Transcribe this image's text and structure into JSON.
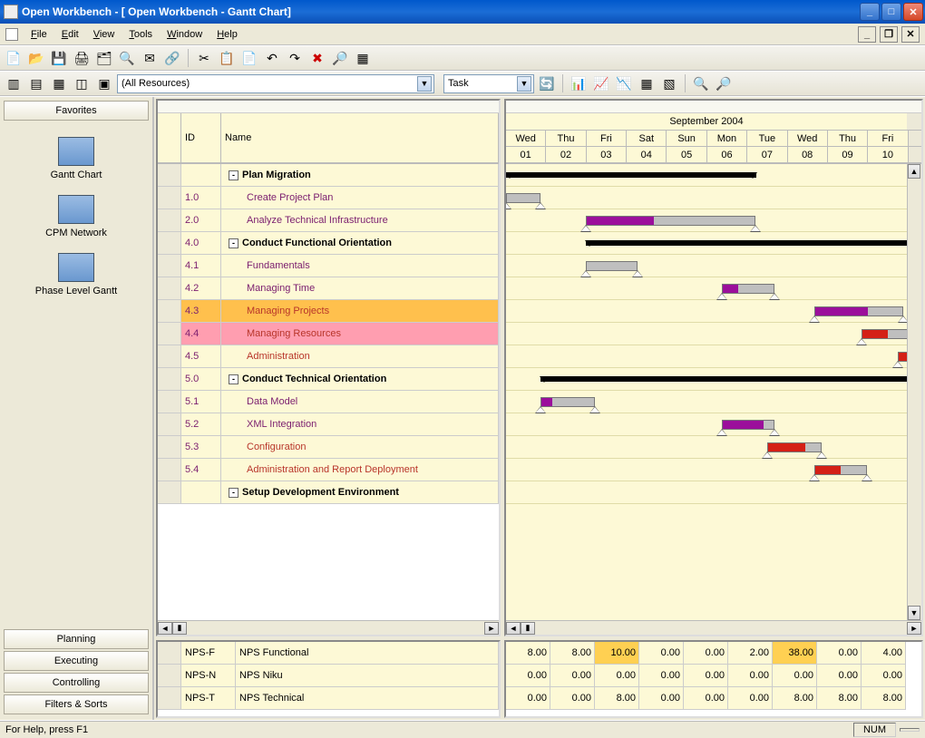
{
  "window": {
    "title": "Open Workbench - [   Open Workbench - Gantt Chart]"
  },
  "menu": {
    "items": [
      "File",
      "Edit",
      "View",
      "Tools",
      "Window",
      "Help"
    ]
  },
  "toolbar2": {
    "resource_filter": "(All Resources)",
    "shown_type": "Task"
  },
  "sidebar": {
    "favorites": "Favorites",
    "views": [
      {
        "label": "Gantt Chart"
      },
      {
        "label": "CPM Network"
      },
      {
        "label": "Phase Level Gantt"
      }
    ],
    "bottom": [
      "Planning",
      "Executing",
      "Controlling",
      "Filters & Sorts"
    ]
  },
  "grid": {
    "headers": {
      "id": "ID",
      "name": "Name"
    },
    "timeline": {
      "month": "September 2004",
      "days": [
        "Wed",
        "Thu",
        "Fri",
        "Sat",
        "Sun",
        "Mon",
        "Tue",
        "Wed",
        "Thu",
        "Fri"
      ],
      "dates": [
        "01",
        "02",
        "03",
        "04",
        "05",
        "06",
        "07",
        "08",
        "09",
        "10"
      ]
    },
    "rows": [
      {
        "id": "",
        "name": "Plan Migration",
        "type": "summary",
        "collapsible": true,
        "bar": {
          "start": 0,
          "end": 276,
          "kind": "summary"
        }
      },
      {
        "id": "1.0",
        "name": "Create Project Plan",
        "type": "task",
        "style": "purple",
        "bar": {
          "start": 0,
          "end": 38,
          "kind": "task",
          "prog": 0
        }
      },
      {
        "id": "2.0",
        "name": "Analyze Technical Infrastructure",
        "type": "task",
        "style": "purple",
        "bar": {
          "start": 88,
          "end": 275,
          "kind": "task",
          "prog": 40,
          "progcolor": "purple"
        }
      },
      {
        "id": "4.0",
        "name": "Conduct Functional Orientation",
        "type": "summary",
        "collapsible": true,
        "bar": {
          "start": 88,
          "end": 450,
          "kind": "summary"
        }
      },
      {
        "id": "4.1",
        "name": "Fundamentals",
        "type": "task",
        "style": "purple",
        "bar": {
          "start": 88,
          "end": 145,
          "kind": "task",
          "prog": 0
        }
      },
      {
        "id": "4.2",
        "name": "Managing Time",
        "type": "task",
        "style": "purple",
        "bar": {
          "start": 238,
          "end": 296,
          "kind": "task",
          "prog": 30,
          "progcolor": "purple"
        }
      },
      {
        "id": "4.3",
        "name": "Managing Projects",
        "type": "task",
        "style": "red",
        "hl": "orange",
        "bar": {
          "start": 340,
          "end": 438,
          "kind": "task",
          "prog": 60,
          "progcolor": "purple"
        }
      },
      {
        "id": "4.4",
        "name": "Managing Resources",
        "type": "task",
        "style": "red",
        "hl": "pink",
        "bar": {
          "start": 392,
          "end": 450,
          "kind": "task",
          "prog": 50,
          "progcolor": "red"
        }
      },
      {
        "id": "4.5",
        "name": "Administration",
        "type": "task",
        "style": "red",
        "bar": {
          "start": 432,
          "end": 450,
          "kind": "task",
          "prog": 100,
          "progcolor": "red"
        }
      },
      {
        "id": "5.0",
        "name": "Conduct Technical Orientation",
        "type": "summary",
        "collapsible": true,
        "bar": {
          "start": 38,
          "end": 450,
          "kind": "summary"
        }
      },
      {
        "id": "5.1",
        "name": "Data Model",
        "type": "task",
        "style": "purple",
        "bar": {
          "start": 38,
          "end": 98,
          "kind": "task",
          "prog": 20,
          "progcolor": "purple"
        }
      },
      {
        "id": "5.2",
        "name": "XML Integration",
        "type": "task",
        "style": "purple",
        "bar": {
          "start": 238,
          "end": 296,
          "kind": "task",
          "prog": 80,
          "progcolor": "purple"
        }
      },
      {
        "id": "5.3",
        "name": "Configuration",
        "type": "task",
        "style": "red",
        "bar": {
          "start": 288,
          "end": 348,
          "kind": "task",
          "prog": 70,
          "progcolor": "red"
        }
      },
      {
        "id": "5.4",
        "name": "Administration and Report Deployment",
        "type": "task",
        "style": "red",
        "bar": {
          "start": 340,
          "end": 398,
          "kind": "task",
          "prog": 50,
          "progcolor": "red"
        }
      },
      {
        "id": "",
        "name": "Setup Development Environment",
        "type": "summary",
        "collapsible": true,
        "bar": null
      }
    ]
  },
  "resources": {
    "rows": [
      {
        "code": "NPS-F",
        "name": "NPS Functional",
        "values": [
          "8.00",
          "8.00",
          "10.00",
          "0.00",
          "0.00",
          "2.00",
          "38.00",
          "0.00",
          "4.00"
        ],
        "hl": [
          2,
          6
        ]
      },
      {
        "code": "NPS-N",
        "name": "NPS Niku",
        "values": [
          "0.00",
          "0.00",
          "0.00",
          "0.00",
          "0.00",
          "0.00",
          "0.00",
          "0.00",
          "0.00"
        ],
        "hl": []
      },
      {
        "code": "NPS-T",
        "name": "NPS Technical",
        "values": [
          "0.00",
          "0.00",
          "8.00",
          "0.00",
          "0.00",
          "0.00",
          "8.00",
          "8.00",
          "8.00"
        ],
        "hl": []
      }
    ]
  },
  "statusbar": {
    "help": "For Help, press F1",
    "num": "NUM"
  }
}
